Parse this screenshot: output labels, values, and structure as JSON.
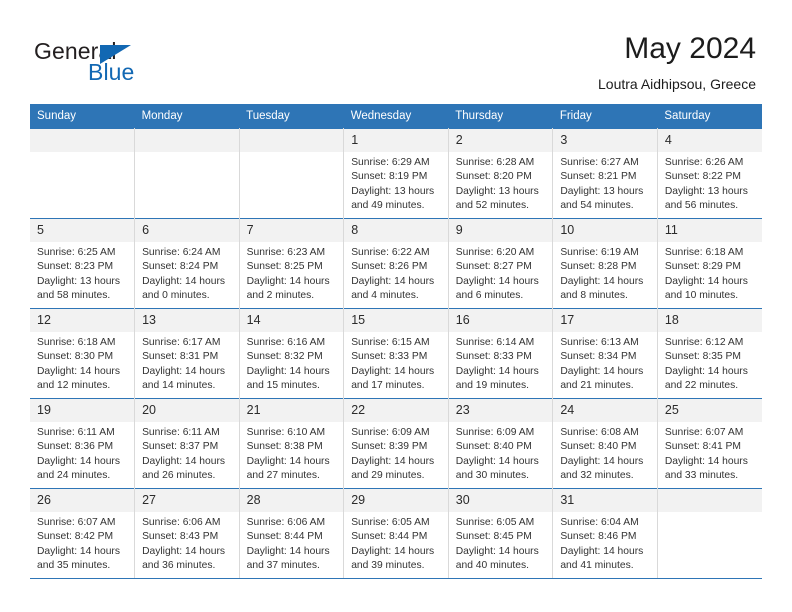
{
  "brand": {
    "name_part1": "General",
    "name_part2": "Blue",
    "triangle_color": "#1268b3"
  },
  "header": {
    "title": "May 2024",
    "subtitle": "Loutra Aidhipsou, Greece"
  },
  "theme": {
    "header_bg": "#2e75b6",
    "daynum_bg": "#f2f2f2",
    "grid_line": "#d9d9d9",
    "text": "#333333"
  },
  "weekdays": [
    "Sunday",
    "Monday",
    "Tuesday",
    "Wednesday",
    "Thursday",
    "Friday",
    "Saturday"
  ],
  "weeks": [
    [
      {
        "day": "",
        "empty": true,
        "sunrise": "",
        "sunset": "",
        "daylight_1": "",
        "daylight_2": ""
      },
      {
        "day": "",
        "empty": true,
        "sunrise": "",
        "sunset": "",
        "daylight_1": "",
        "daylight_2": ""
      },
      {
        "day": "",
        "empty": true,
        "sunrise": "",
        "sunset": "",
        "daylight_1": "",
        "daylight_2": ""
      },
      {
        "day": "1",
        "empty": false,
        "sunrise": "Sunrise: 6:29 AM",
        "sunset": "Sunset: 8:19 PM",
        "daylight_1": "Daylight: 13 hours",
        "daylight_2": "and 49 minutes."
      },
      {
        "day": "2",
        "empty": false,
        "sunrise": "Sunrise: 6:28 AM",
        "sunset": "Sunset: 8:20 PM",
        "daylight_1": "Daylight: 13 hours",
        "daylight_2": "and 52 minutes."
      },
      {
        "day": "3",
        "empty": false,
        "sunrise": "Sunrise: 6:27 AM",
        "sunset": "Sunset: 8:21 PM",
        "daylight_1": "Daylight: 13 hours",
        "daylight_2": "and 54 minutes."
      },
      {
        "day": "4",
        "empty": false,
        "sunrise": "Sunrise: 6:26 AM",
        "sunset": "Sunset: 8:22 PM",
        "daylight_1": "Daylight: 13 hours",
        "daylight_2": "and 56 minutes."
      }
    ],
    [
      {
        "day": "5",
        "empty": false,
        "sunrise": "Sunrise: 6:25 AM",
        "sunset": "Sunset: 8:23 PM",
        "daylight_1": "Daylight: 13 hours",
        "daylight_2": "and 58 minutes."
      },
      {
        "day": "6",
        "empty": false,
        "sunrise": "Sunrise: 6:24 AM",
        "sunset": "Sunset: 8:24 PM",
        "daylight_1": "Daylight: 14 hours",
        "daylight_2": "and 0 minutes."
      },
      {
        "day": "7",
        "empty": false,
        "sunrise": "Sunrise: 6:23 AM",
        "sunset": "Sunset: 8:25 PM",
        "daylight_1": "Daylight: 14 hours",
        "daylight_2": "and 2 minutes."
      },
      {
        "day": "8",
        "empty": false,
        "sunrise": "Sunrise: 6:22 AM",
        "sunset": "Sunset: 8:26 PM",
        "daylight_1": "Daylight: 14 hours",
        "daylight_2": "and 4 minutes."
      },
      {
        "day": "9",
        "empty": false,
        "sunrise": "Sunrise: 6:20 AM",
        "sunset": "Sunset: 8:27 PM",
        "daylight_1": "Daylight: 14 hours",
        "daylight_2": "and 6 minutes."
      },
      {
        "day": "10",
        "empty": false,
        "sunrise": "Sunrise: 6:19 AM",
        "sunset": "Sunset: 8:28 PM",
        "daylight_1": "Daylight: 14 hours",
        "daylight_2": "and 8 minutes."
      },
      {
        "day": "11",
        "empty": false,
        "sunrise": "Sunrise: 6:18 AM",
        "sunset": "Sunset: 8:29 PM",
        "daylight_1": "Daylight: 14 hours",
        "daylight_2": "and 10 minutes."
      }
    ],
    [
      {
        "day": "12",
        "empty": false,
        "sunrise": "Sunrise: 6:18 AM",
        "sunset": "Sunset: 8:30 PM",
        "daylight_1": "Daylight: 14 hours",
        "daylight_2": "and 12 minutes."
      },
      {
        "day": "13",
        "empty": false,
        "sunrise": "Sunrise: 6:17 AM",
        "sunset": "Sunset: 8:31 PM",
        "daylight_1": "Daylight: 14 hours",
        "daylight_2": "and 14 minutes."
      },
      {
        "day": "14",
        "empty": false,
        "sunrise": "Sunrise: 6:16 AM",
        "sunset": "Sunset: 8:32 PM",
        "daylight_1": "Daylight: 14 hours",
        "daylight_2": "and 15 minutes."
      },
      {
        "day": "15",
        "empty": false,
        "sunrise": "Sunrise: 6:15 AM",
        "sunset": "Sunset: 8:33 PM",
        "daylight_1": "Daylight: 14 hours",
        "daylight_2": "and 17 minutes."
      },
      {
        "day": "16",
        "empty": false,
        "sunrise": "Sunrise: 6:14 AM",
        "sunset": "Sunset: 8:33 PM",
        "daylight_1": "Daylight: 14 hours",
        "daylight_2": "and 19 minutes."
      },
      {
        "day": "17",
        "empty": false,
        "sunrise": "Sunrise: 6:13 AM",
        "sunset": "Sunset: 8:34 PM",
        "daylight_1": "Daylight: 14 hours",
        "daylight_2": "and 21 minutes."
      },
      {
        "day": "18",
        "empty": false,
        "sunrise": "Sunrise: 6:12 AM",
        "sunset": "Sunset: 8:35 PM",
        "daylight_1": "Daylight: 14 hours",
        "daylight_2": "and 22 minutes."
      }
    ],
    [
      {
        "day": "19",
        "empty": false,
        "sunrise": "Sunrise: 6:11 AM",
        "sunset": "Sunset: 8:36 PM",
        "daylight_1": "Daylight: 14 hours",
        "daylight_2": "and 24 minutes."
      },
      {
        "day": "20",
        "empty": false,
        "sunrise": "Sunrise: 6:11 AM",
        "sunset": "Sunset: 8:37 PM",
        "daylight_1": "Daylight: 14 hours",
        "daylight_2": "and 26 minutes."
      },
      {
        "day": "21",
        "empty": false,
        "sunrise": "Sunrise: 6:10 AM",
        "sunset": "Sunset: 8:38 PM",
        "daylight_1": "Daylight: 14 hours",
        "daylight_2": "and 27 minutes."
      },
      {
        "day": "22",
        "empty": false,
        "sunrise": "Sunrise: 6:09 AM",
        "sunset": "Sunset: 8:39 PM",
        "daylight_1": "Daylight: 14 hours",
        "daylight_2": "and 29 minutes."
      },
      {
        "day": "23",
        "empty": false,
        "sunrise": "Sunrise: 6:09 AM",
        "sunset": "Sunset: 8:40 PM",
        "daylight_1": "Daylight: 14 hours",
        "daylight_2": "and 30 minutes."
      },
      {
        "day": "24",
        "empty": false,
        "sunrise": "Sunrise: 6:08 AM",
        "sunset": "Sunset: 8:40 PM",
        "daylight_1": "Daylight: 14 hours",
        "daylight_2": "and 32 minutes."
      },
      {
        "day": "25",
        "empty": false,
        "sunrise": "Sunrise: 6:07 AM",
        "sunset": "Sunset: 8:41 PM",
        "daylight_1": "Daylight: 14 hours",
        "daylight_2": "and 33 minutes."
      }
    ],
    [
      {
        "day": "26",
        "empty": false,
        "sunrise": "Sunrise: 6:07 AM",
        "sunset": "Sunset: 8:42 PM",
        "daylight_1": "Daylight: 14 hours",
        "daylight_2": "and 35 minutes."
      },
      {
        "day": "27",
        "empty": false,
        "sunrise": "Sunrise: 6:06 AM",
        "sunset": "Sunset: 8:43 PM",
        "daylight_1": "Daylight: 14 hours",
        "daylight_2": "and 36 minutes."
      },
      {
        "day": "28",
        "empty": false,
        "sunrise": "Sunrise: 6:06 AM",
        "sunset": "Sunset: 8:44 PM",
        "daylight_1": "Daylight: 14 hours",
        "daylight_2": "and 37 minutes."
      },
      {
        "day": "29",
        "empty": false,
        "sunrise": "Sunrise: 6:05 AM",
        "sunset": "Sunset: 8:44 PM",
        "daylight_1": "Daylight: 14 hours",
        "daylight_2": "and 39 minutes."
      },
      {
        "day": "30",
        "empty": false,
        "sunrise": "Sunrise: 6:05 AM",
        "sunset": "Sunset: 8:45 PM",
        "daylight_1": "Daylight: 14 hours",
        "daylight_2": "and 40 minutes."
      },
      {
        "day": "31",
        "empty": false,
        "sunrise": "Sunrise: 6:04 AM",
        "sunset": "Sunset: 8:46 PM",
        "daylight_1": "Daylight: 14 hours",
        "daylight_2": "and 41 minutes."
      },
      {
        "day": "",
        "empty": true,
        "sunrise": "",
        "sunset": "",
        "daylight_1": "",
        "daylight_2": ""
      }
    ]
  ]
}
